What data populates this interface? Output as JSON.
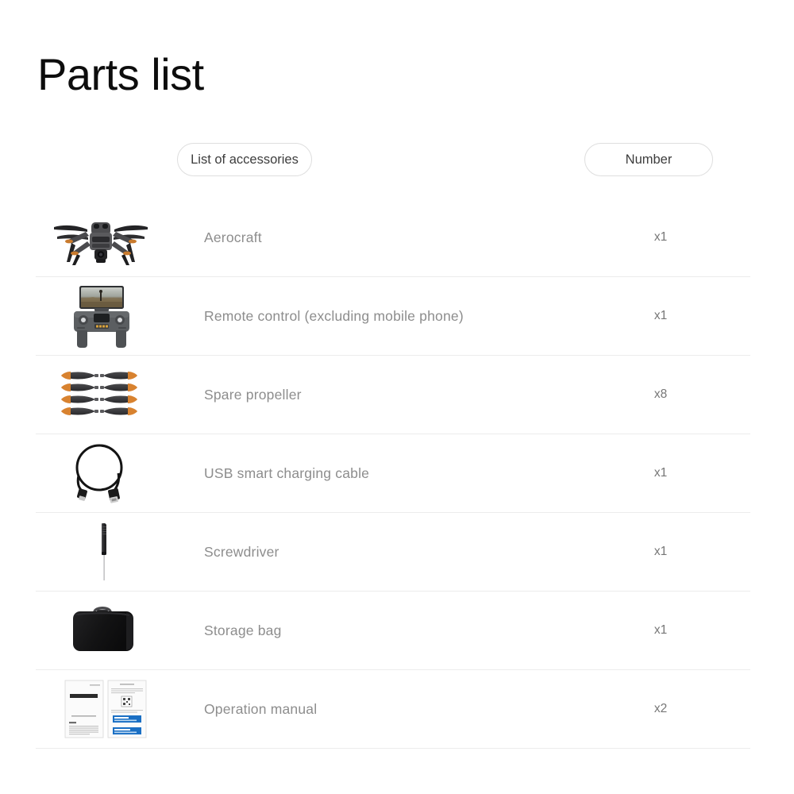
{
  "page": {
    "title": "Parts list",
    "background": "#ffffff",
    "title_color": "#0d0d0d"
  },
  "header": {
    "accessories_label": "List of accessories",
    "number_label": "Number",
    "pill_border_color": "#dedede",
    "pill_text_color": "#3d3d3d"
  },
  "table": {
    "label_color": "#8d8d8d",
    "qty_color": "#767676",
    "divider_color": "#ececec",
    "rows": [
      {
        "icon": "drone-icon",
        "label": "Aerocraft",
        "qty": "x1"
      },
      {
        "icon": "remote-control-icon",
        "label": "Remote control (excluding mobile phone)",
        "qty": "x1"
      },
      {
        "icon": "propeller-icon",
        "label": "Spare propeller",
        "qty": "x8"
      },
      {
        "icon": "usb-cable-icon",
        "label": "USB smart charging cable",
        "qty": "x1"
      },
      {
        "icon": "screwdriver-icon",
        "label": "Screwdriver",
        "qty": "x1"
      },
      {
        "icon": "storage-bag-icon",
        "label": "Storage bag",
        "qty": "x1"
      },
      {
        "icon": "manual-icon",
        "label": "Operation manual",
        "qty": "x2"
      }
    ]
  },
  "colors": {
    "propeller_body": "#3f3f41",
    "propeller_tip": "#d8822f",
    "drone_body": "#565659",
    "bag_black": "#161616",
    "manual_blue": "#1a6fc4"
  }
}
